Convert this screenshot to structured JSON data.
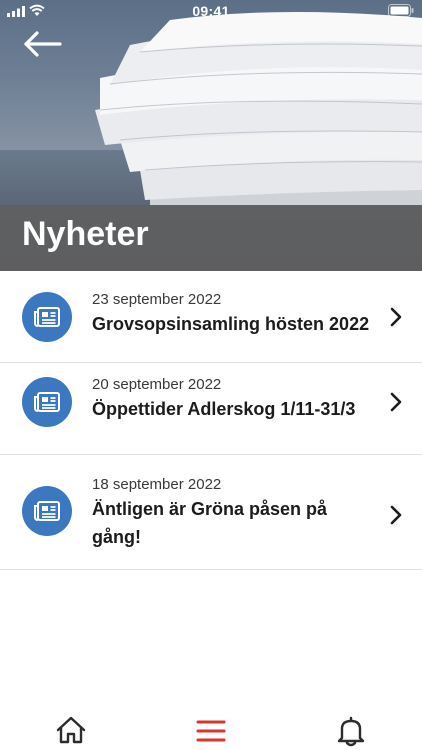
{
  "status_bar": {
    "time": "09:41"
  },
  "header": {
    "title": "Nyheter",
    "back_icon": "arrow-left-icon"
  },
  "news": [
    {
      "date": "23 september 2022",
      "title": "Grovsopsinsamling hösten 2022",
      "icon": "newspaper-icon"
    },
    {
      "date": "20 september 2022",
      "title": "Öppettider Adlerskog 1/11-31/3",
      "icon": "newspaper-icon"
    },
    {
      "date": "18 september 2022",
      "title": "Äntligen är Gröna påsen på gång!",
      "icon": "newspaper-icon"
    }
  ],
  "tabbar": {
    "items": [
      {
        "icon": "home-icon",
        "active": false
      },
      {
        "icon": "menu-icon",
        "active": true
      },
      {
        "icon": "bell-icon",
        "active": false
      }
    ]
  },
  "colors": {
    "accent": "#3b78bf",
    "active_tab": "#d9352c",
    "title_band": "#606060"
  }
}
